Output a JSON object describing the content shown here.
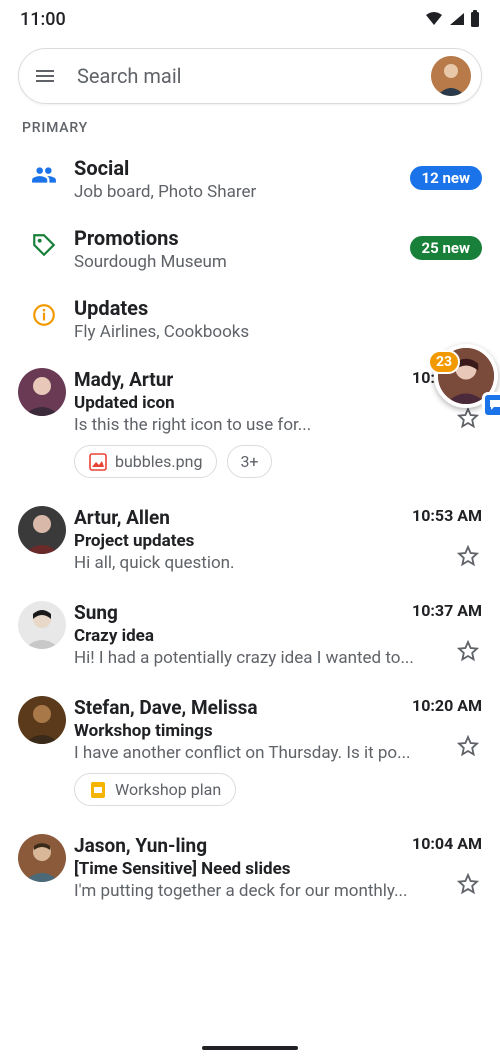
{
  "status": {
    "time": "11:00"
  },
  "search": {
    "placeholder": "Search mail"
  },
  "section_label": "PRIMARY",
  "categories": [
    {
      "title": "Social",
      "sub": "Job board, Photo Sharer",
      "badge": "12 new",
      "badge_color": "blue",
      "icon": "people"
    },
    {
      "title": "Promotions",
      "sub": "Sourdough Museum",
      "badge": "25 new",
      "badge_color": "green",
      "icon": "tag"
    },
    {
      "title": "Updates",
      "sub": "Fly Airlines, Cookbooks",
      "badge": "",
      "badge_color": "",
      "icon": "info"
    }
  ],
  "chat_head": {
    "badge": "23"
  },
  "emails": [
    {
      "sender": "Mady, Artur",
      "time": "10:55 AM",
      "subject": "Updated icon",
      "snippet": "Is this the right icon to use for...",
      "chips": [
        {
          "icon": "image",
          "label": "bubbles.png"
        },
        {
          "icon": "",
          "label": "3+"
        }
      ],
      "avatar_color": "#6a3a55"
    },
    {
      "sender": "Artur, Allen",
      "time": "10:53 AM",
      "subject": "Project updates",
      "snippet": "Hi all, quick question.",
      "chips": [],
      "avatar_color": "#3a3a3a"
    },
    {
      "sender": "Sung",
      "time": "10:37 AM",
      "subject": "Crazy idea",
      "snippet": "Hi! I had a potentially crazy idea I wanted to...",
      "chips": [],
      "avatar_color": "#e8e8e8"
    },
    {
      "sender": "Stefan, Dave, Melissa",
      "time": "10:20 AM",
      "subject": "Workshop timings",
      "snippet": "I have another conflict on Thursday. Is it po...",
      "chips": [
        {
          "icon": "slides",
          "label": "Workshop plan"
        }
      ],
      "avatar_color": "#5a3a1a"
    },
    {
      "sender": "Jason, Yun-ling",
      "time": "10:04 AM",
      "subject": "[Time Sensitive] Need slides",
      "snippet": "I'm putting together a deck for our monthly...",
      "chips": [],
      "avatar_color": "#8a5a3a"
    }
  ]
}
